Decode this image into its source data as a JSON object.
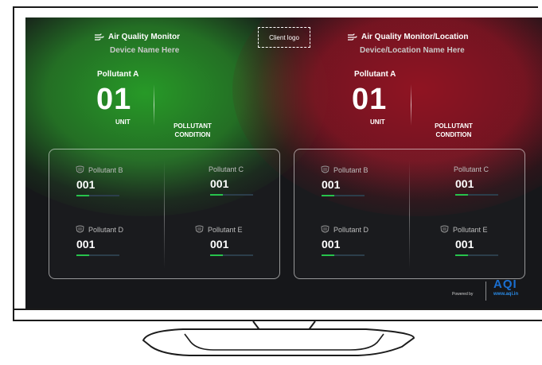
{
  "left": {
    "title": "Air Quality Monitor",
    "subtitle": "Device Name Here",
    "pollutant_label": "Pollutant A",
    "value": "01",
    "unit": "UNIT",
    "condition_line1": "POLLUTANT",
    "condition_line2": "CONDITION",
    "glow_color": "#2e9e2e",
    "cells": [
      {
        "name": "Pollutant B",
        "value": "001",
        "level": 0.3
      },
      {
        "name": "Pollutant C",
        "value": "001",
        "level": 0.3
      },
      {
        "name": "Pollutant D",
        "value": "001",
        "level": 0.3
      },
      {
        "name": "Pollutant E",
        "value": "001",
        "level": 0.3
      }
    ]
  },
  "right": {
    "title": "Air Quality Monitor/Location",
    "subtitle": "Device/Location Name Here",
    "pollutant_label": "Pollutant A",
    "value": "01",
    "unit": "UNIT",
    "condition_line1": "POLLUTANT",
    "condition_line2": "CONDITION",
    "glow_color": "#961423",
    "cells": [
      {
        "name": "Pollutant B",
        "value": "001",
        "level": 0.3
      },
      {
        "name": "Pollutant C",
        "value": "001",
        "level": 0.3
      },
      {
        "name": "Pollutant D",
        "value": "001",
        "level": 0.3
      },
      {
        "name": "Pollutant E",
        "value": "001",
        "level": 0.3
      }
    ]
  },
  "client_logo": "Client logo",
  "footer": {
    "powered_by": "Powered by",
    "brand": "AQI",
    "url": "www.aqi.in"
  },
  "icons": {
    "title_icon": "wind-icon",
    "cell_icon": "mask-icon"
  },
  "colors": {
    "bar_fill": "#27c24c",
    "bar_track": "#2c3e4b",
    "brand_blue": "#1a6fd1"
  }
}
